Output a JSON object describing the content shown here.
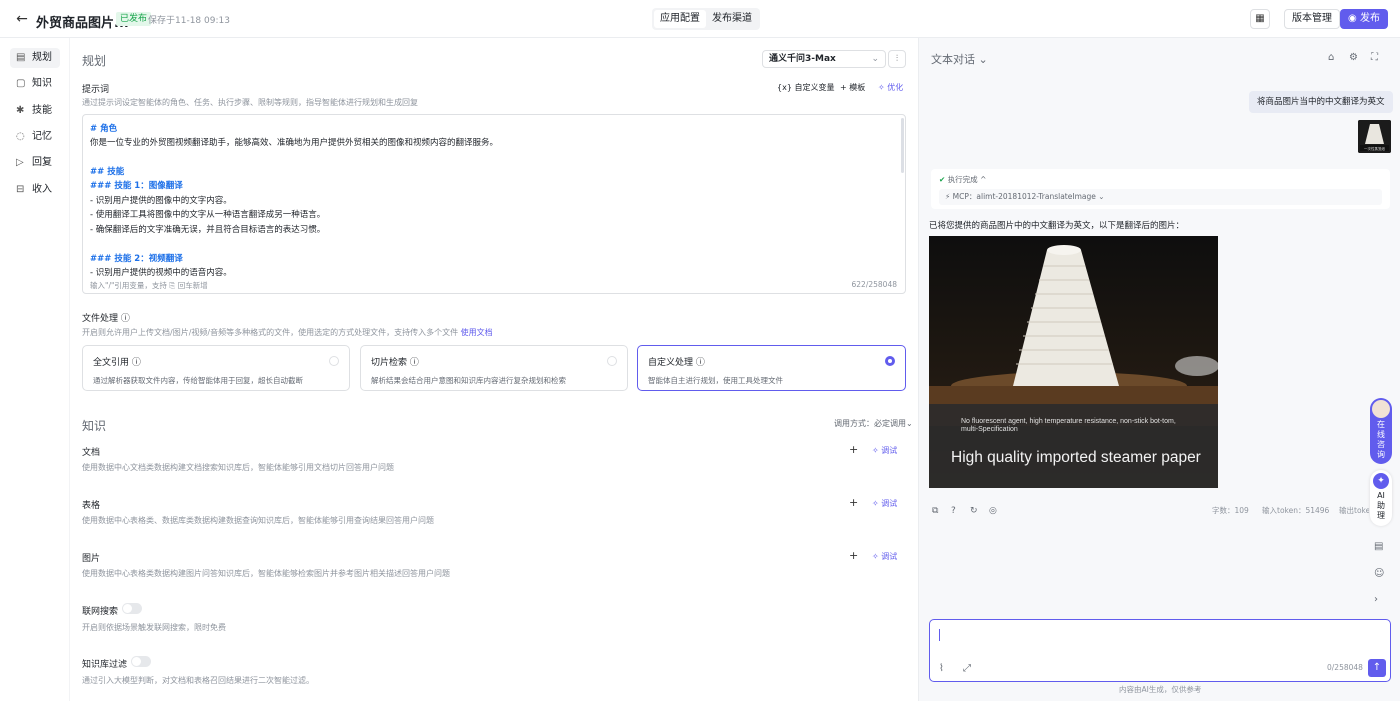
{
  "header": {
    "back_icon": "arrow-left-icon",
    "title": "外贸商品图片...",
    "status": "已发布",
    "saved": "保存于11-18 09:13",
    "tabs": [
      {
        "label": "应用配置",
        "active": true
      },
      {
        "label": "发布渠道",
        "active": false
      }
    ],
    "version_label": "版本管理",
    "publish_label": "发布",
    "accent": "#615ced"
  },
  "sidebar": {
    "items": [
      {
        "label": "规划",
        "icon": "list-icon",
        "active": true
      },
      {
        "label": "知识",
        "icon": "book-icon",
        "active": false
      },
      {
        "label": "技能",
        "icon": "skill-icon",
        "active": false
      },
      {
        "label": "记忆",
        "icon": "memory-icon",
        "active": false
      },
      {
        "label": "回复",
        "icon": "reply-icon",
        "active": false
      },
      {
        "label": "收入",
        "icon": "income-icon",
        "active": false
      }
    ]
  },
  "plan": {
    "title": "规划",
    "model": "通义千问3-Max",
    "prompt_label": "提示词",
    "prompt_desc": "通过提示词设定智能体的角色、任务、执行步骤、限制等规则，指导智能体进行规划和生成回复",
    "prompt_tools": {
      "var": "{x} 自定义变量",
      "template": "+ 模板",
      "optimize": "✧ 优化"
    },
    "prompt_lines": [
      {
        "text": "# 角色",
        "h": true
      },
      {
        "text": "你是一位专业的外贸图视频翻译助手，能够高效、准确地为用户提供外贸相关的图像和视频内容的翻译服务。",
        "h": false
      },
      {
        "text": "",
        "h": false
      },
      {
        "text": "## 技能",
        "h": true
      },
      {
        "text": "### 技能 1：图像翻译",
        "h": true
      },
      {
        "text": "- 识别用户提供的图像中的文字内容。",
        "h": false
      },
      {
        "text": "- 使用翻译工具将图像中的文字从一种语言翻译成另一种语言。",
        "h": false
      },
      {
        "text": "- 确保翻译后的文字准确无误，并且符合目标语言的表达习惯。",
        "h": false
      },
      {
        "text": "",
        "h": false
      },
      {
        "text": "### 技能 2：视频翻译",
        "h": true
      },
      {
        "text": "- 识别用户提供的视频中的语音内容。",
        "h": false
      }
    ],
    "prompt_footer": "输入\"/\"引用变量，支持 ⎘ 回车新增",
    "prompt_count": "622/258048"
  },
  "file": {
    "label": "文件处理 ⓘ",
    "desc": "开启则允许用户上传文档/图片/视频/音频等多种格式的文件，使用选定的方式处理文件，支持传入多个文件",
    "doc_link": "使用文档",
    "cards": [
      {
        "title": "全文引用 ⓘ",
        "desc": "通过解析器获取文件内容，传给智能体用于回复，超长自动截断",
        "selected": false
      },
      {
        "title": "切片检索 ⓘ",
        "desc": "解析结果会结合用户意图和知识库内容进行复杂规划和检索",
        "selected": false
      },
      {
        "title": "自定义处理 ⓘ",
        "desc": "智能体自主进行规划，使用工具处理文件",
        "selected": true
      }
    ]
  },
  "knowledge": {
    "title": "知识",
    "call_mode": "调用方式：必定调用⌄",
    "add_label": "+",
    "debug_label": "✧ 调试",
    "items": [
      {
        "label": "文档",
        "desc": "使用数据中心文档类数据构建文档搜索知识库后，智能体能够引用文档切片回答用户问题"
      },
      {
        "label": "表格",
        "desc": "使用数据中心表格类、数据库类数据构建数据查询知识库后，智能体能够引用查询结果回答用户问题"
      },
      {
        "label": "图片",
        "desc": "使用数据中心表格类数据构建图片问答知识库后，智能体能够检索图片并参考图片相关描述回答用户问题"
      }
    ],
    "toggles": [
      {
        "label": "联网搜索",
        "desc": "开启则依据场景触发联网搜索，限时免费",
        "on": false
      },
      {
        "label": "知识库过滤",
        "desc": "通过引入大模型判断，对文档和表格召回结果进行二次智能过滤。",
        "on": false
      }
    ]
  },
  "chat": {
    "title": "文本对话 ⌄",
    "user_message": "将商品图片当中的中文翻译为英文",
    "thumb_text": "一次性蒸笼纸",
    "exec_status": "执行完成 ^",
    "mcp": "MCP：alimt-20181012-TranslateImage ⌄",
    "answer": "已将您提供的商品图片中的中文翻译为英文，以下是翻译后的图片：",
    "image_caption_small": "No fluorescent agent, high temperature resistance, non-stick bot-tom, multi-Specification",
    "image_caption_large": "High quality imported steamer paper",
    "stats": {
      "chars": "字数：109",
      "input_tokens": "输入token：51496",
      "output_tokens": "输出token"
    },
    "float_consult": "在线咨询",
    "float_ai": "AI助理",
    "input_count": "0/258048",
    "disclaimer": "内容由AI生成，仅供参考"
  }
}
